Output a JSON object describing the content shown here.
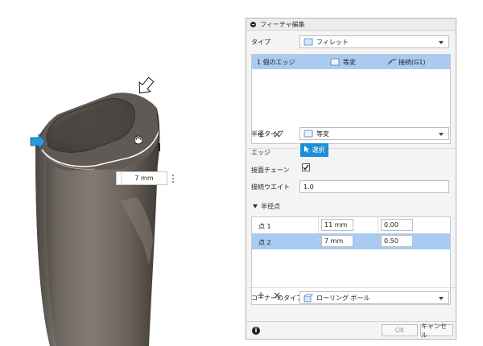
{
  "viewport": {
    "dimension_value": "7 mm"
  },
  "dialog": {
    "title": "フィーチャ編集",
    "type": {
      "label": "タイプ",
      "value": "フィレット"
    },
    "edge_list": {
      "row_label": "1 個のエッジ",
      "radius_type": "等変",
      "continuity": "接続(G1)",
      "add": "+",
      "remove": "×"
    },
    "radius_type": {
      "label": "半径タイプ",
      "value": "等変"
    },
    "edge": {
      "label": "エッジ",
      "select": "選択"
    },
    "tangent_chain": {
      "label": "接面チェーン",
      "checked": true
    },
    "tangent_weight": {
      "label": "接続ウエイト",
      "value": "1.0"
    },
    "radius_points": {
      "heading": "半径点",
      "rows": [
        {
          "name": "点 1",
          "radius": "11 mm",
          "position": "0.00",
          "selected": false
        },
        {
          "name": "点 2",
          "radius": "7 mm",
          "position": "0.50",
          "selected": true
        }
      ],
      "add": "+",
      "remove": "×"
    },
    "corner_type": {
      "label": "コーナーのタイプ",
      "value": "ローリング ボール"
    },
    "buttons": {
      "ok": "OK",
      "cancel": "キャンセル"
    }
  },
  "colors": {
    "accent": "#1e8fd2",
    "selection": "#a9cbf2",
    "body": "#6e6660",
    "top_face": "#514b46",
    "edge_highlight": "#ffffff"
  }
}
